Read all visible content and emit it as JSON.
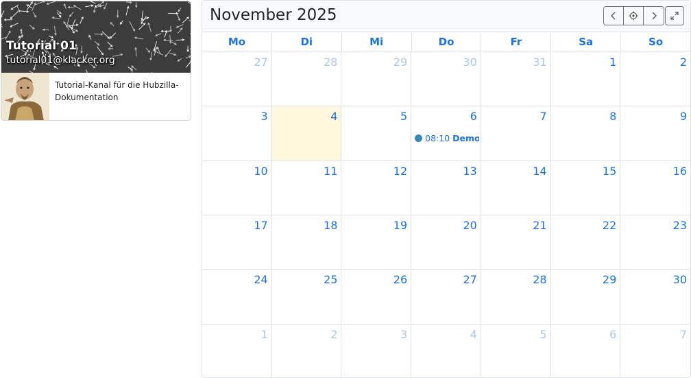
{
  "profile": {
    "name": "Tutorial 01",
    "address": "tutorial01@klacker.org",
    "description": "Tutorial-Kanal für die Hubzilla-Dokumentation"
  },
  "calendar": {
    "title": "November 2025",
    "buttons": {
      "prev": "chevron-left-icon",
      "today": "crosshair-icon",
      "next": "chevron-right-icon",
      "expand": "expand-icon"
    },
    "weekdays": [
      "Mo",
      "Di",
      "Mi",
      "Do",
      "Fr",
      "Sa",
      "So"
    ],
    "weeks": [
      [
        {
          "d": "27",
          "o": true
        },
        {
          "d": "28",
          "o": true
        },
        {
          "d": "29",
          "o": true
        },
        {
          "d": "30",
          "o": true
        },
        {
          "d": "31",
          "o": true
        },
        {
          "d": "1"
        },
        {
          "d": "2"
        }
      ],
      [
        {
          "d": "3"
        },
        {
          "d": "4",
          "today": true
        },
        {
          "d": "5"
        },
        {
          "d": "6",
          "event": {
            "time": "08:10",
            "title": "Demo-"
          }
        },
        {
          "d": "7"
        },
        {
          "d": "8"
        },
        {
          "d": "9"
        }
      ],
      [
        {
          "d": "10"
        },
        {
          "d": "11"
        },
        {
          "d": "12"
        },
        {
          "d": "13"
        },
        {
          "d": "14"
        },
        {
          "d": "15"
        },
        {
          "d": "16"
        }
      ],
      [
        {
          "d": "17"
        },
        {
          "d": "18"
        },
        {
          "d": "19"
        },
        {
          "d": "20"
        },
        {
          "d": "21"
        },
        {
          "d": "22"
        },
        {
          "d": "23"
        }
      ],
      [
        {
          "d": "24"
        },
        {
          "d": "25"
        },
        {
          "d": "26"
        },
        {
          "d": "27"
        },
        {
          "d": "28"
        },
        {
          "d": "29"
        },
        {
          "d": "30"
        }
      ],
      [
        {
          "d": "1",
          "o": true
        },
        {
          "d": "2",
          "o": true
        },
        {
          "d": "3",
          "o": true
        },
        {
          "d": "4",
          "o": true
        },
        {
          "d": "5",
          "o": true
        },
        {
          "d": "6",
          "o": true
        },
        {
          "d": "7",
          "o": true
        }
      ]
    ],
    "colors": {
      "accent": "#1a73e8",
      "other_month": "#a9c8ee",
      "today_bg": "#fff8dc",
      "event_dot": "#3788b8"
    }
  }
}
